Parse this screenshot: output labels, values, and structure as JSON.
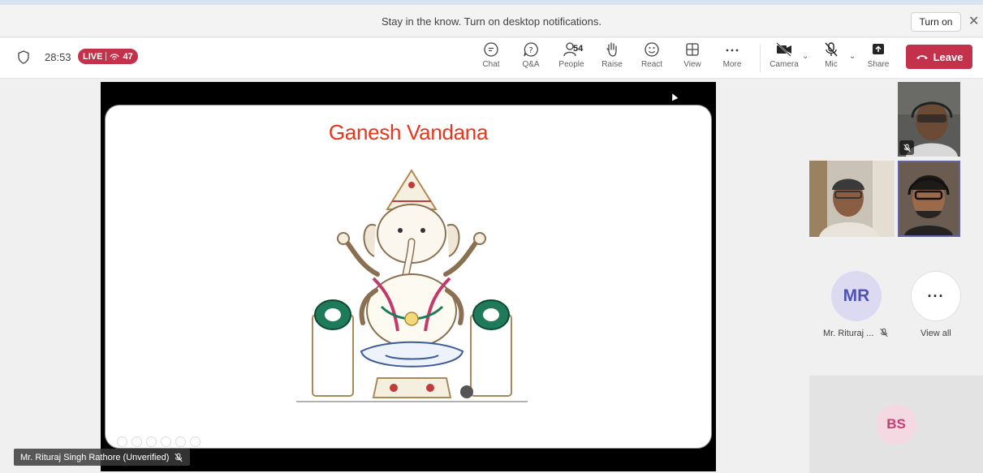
{
  "notification": {
    "text": "Stay in the know. Turn on desktop notifications.",
    "turn_on_label": "Turn on",
    "close_glyph": "✕"
  },
  "meeting": {
    "elapsed": "28:53",
    "live_label": "LIVE",
    "viewer_count": "47"
  },
  "toolbar": {
    "chat_label": "Chat",
    "qa_label": "Q&A",
    "people_label": "People",
    "people_count": "54",
    "raise_label": "Raise",
    "react_label": "React",
    "view_label": "View",
    "more_label": "More",
    "camera_label": "Camera",
    "mic_label": "Mic",
    "share_label": "Share",
    "leave_label": "Leave"
  },
  "slide": {
    "title": "Ganesh Vandana"
  },
  "presenter": {
    "name": "Mr. Rituraj Singh Rathore (Unverified)"
  },
  "participants": {
    "mr_initials": "MR",
    "mr_name": "Mr. Rituraj ...",
    "view_all_label": "View all",
    "view_all_glyph": "···",
    "bs_initials": "BS"
  },
  "colors": {
    "leave": "#c4314b",
    "live": "#c4314b",
    "slide_title": "#e8361c",
    "accent": "#6264a7"
  }
}
